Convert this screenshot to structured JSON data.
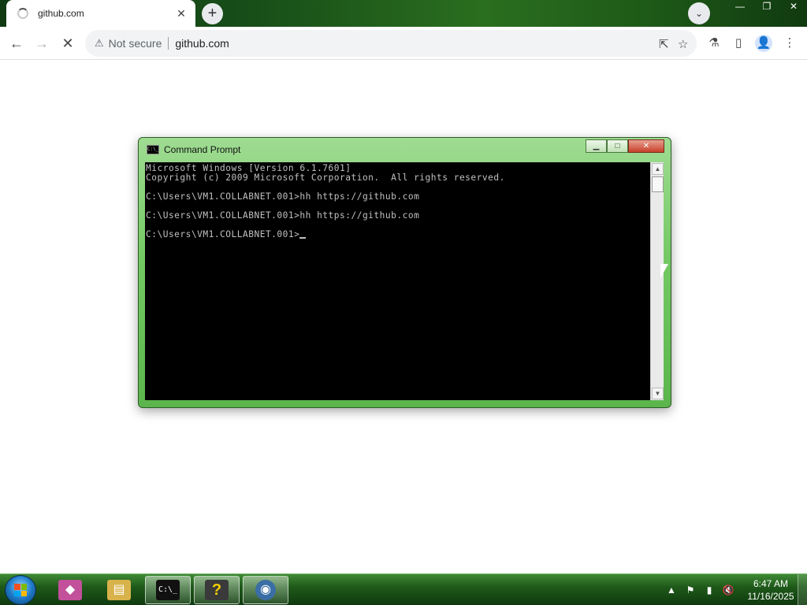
{
  "browser": {
    "tab": {
      "title": "github.com",
      "close": "✕"
    },
    "new_tab": "+",
    "tab_search": "⌄",
    "window_controls": {
      "minimize": "—",
      "restore": "❐",
      "close": "✕"
    },
    "nav": {
      "back": "←",
      "forward": "→",
      "stop": "✕"
    },
    "omnibox": {
      "security_label": "Not secure",
      "warning_icon": "⚠",
      "url": "github.com"
    },
    "toolbar_icons": {
      "share": "⇱",
      "bookmark": "☆",
      "labs": "⚗",
      "side_panel": "▯",
      "profile": "👤",
      "menu": "⋮"
    }
  },
  "cmd": {
    "title": "Command Prompt",
    "icon_text": "C:\\_",
    "controls": {
      "minimize": "▁",
      "maximize": "□",
      "close": "✕"
    },
    "lines": [
      "Microsoft Windows [Version 6.1.7601]",
      "Copyright (c) 2009 Microsoft Corporation.  All rights reserved.",
      "",
      "C:\\Users\\VM1.COLLABNET.001>hh https://github.com",
      "",
      "C:\\Users\\VM1.COLLABNET.001>hh https://github.com",
      "",
      "C:\\Users\\VM1.COLLABNET.001>"
    ],
    "scroll": {
      "up": "▲",
      "down": "▼"
    }
  },
  "taskbar": {
    "items": [
      {
        "name": "visual-studio",
        "glyph": "◆",
        "color": "#c2509a"
      },
      {
        "name": "explorer",
        "glyph": "▤",
        "color": "#d8b24a"
      },
      {
        "name": "command-prompt",
        "glyph": "C:\\_",
        "color": "#111111",
        "active": true
      },
      {
        "name": "help",
        "glyph": "?",
        "color": "#3a3a3a"
      },
      {
        "name": "chrome",
        "glyph": "◉",
        "color": "#3a6ea5"
      }
    ],
    "tray": {
      "show_hidden": "▲",
      "action_center": "⚑",
      "network": "▮",
      "volume": "🔇"
    },
    "clock": {
      "time": "6:47 AM",
      "date": "11/16/2025"
    }
  }
}
